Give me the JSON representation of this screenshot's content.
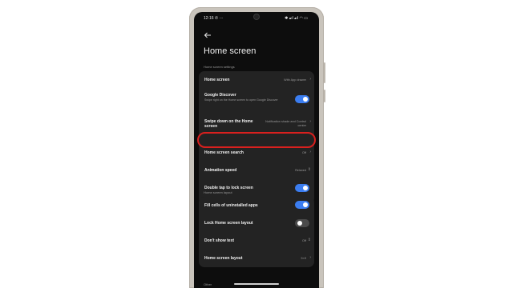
{
  "status_bar": {
    "time": "12:16",
    "left_icons": "✆ ···",
    "right_icons": "✱ ▴ıl ▴ıl ◠ ▭"
  },
  "header": {
    "back_icon": "arrow-left-icon",
    "title": "Home screen"
  },
  "sections": {
    "settings_label": "Home screen settings",
    "layout_label": "Home screen layout",
    "other_label": "Other"
  },
  "settings": {
    "home_screen": {
      "title": "Home screen",
      "value": "With App drawer"
    },
    "google_discover": {
      "title": "Google Discover",
      "subtitle": "Swipe right on the Home screen to open Google Discover",
      "enabled": true
    },
    "swipe_down": {
      "title": "Swipe down on the Home screen",
      "value": "Notification shade and Control center"
    },
    "home_search": {
      "title": "Home screen search",
      "value": "Off"
    },
    "animation_speed": {
      "title": "Animation speed",
      "value": "Relaxed"
    },
    "double_tap_lock": {
      "title": "Double tap to lock screen",
      "enabled": true
    }
  },
  "layout": {
    "fill_cells": {
      "title": "Fill cells of uninstalled apps",
      "enabled": true
    },
    "lock_layout": {
      "title": "Lock Home screen layout",
      "enabled": false
    },
    "dont_show_text": {
      "title": "Don't show text",
      "value": "Off"
    },
    "home_layout": {
      "title": "Home screen layout",
      "value": "5×9"
    }
  },
  "colors": {
    "accent": "#3b7df0",
    "highlight": "#d8201e",
    "card": "#232323",
    "screen": "#0d0d0d"
  }
}
